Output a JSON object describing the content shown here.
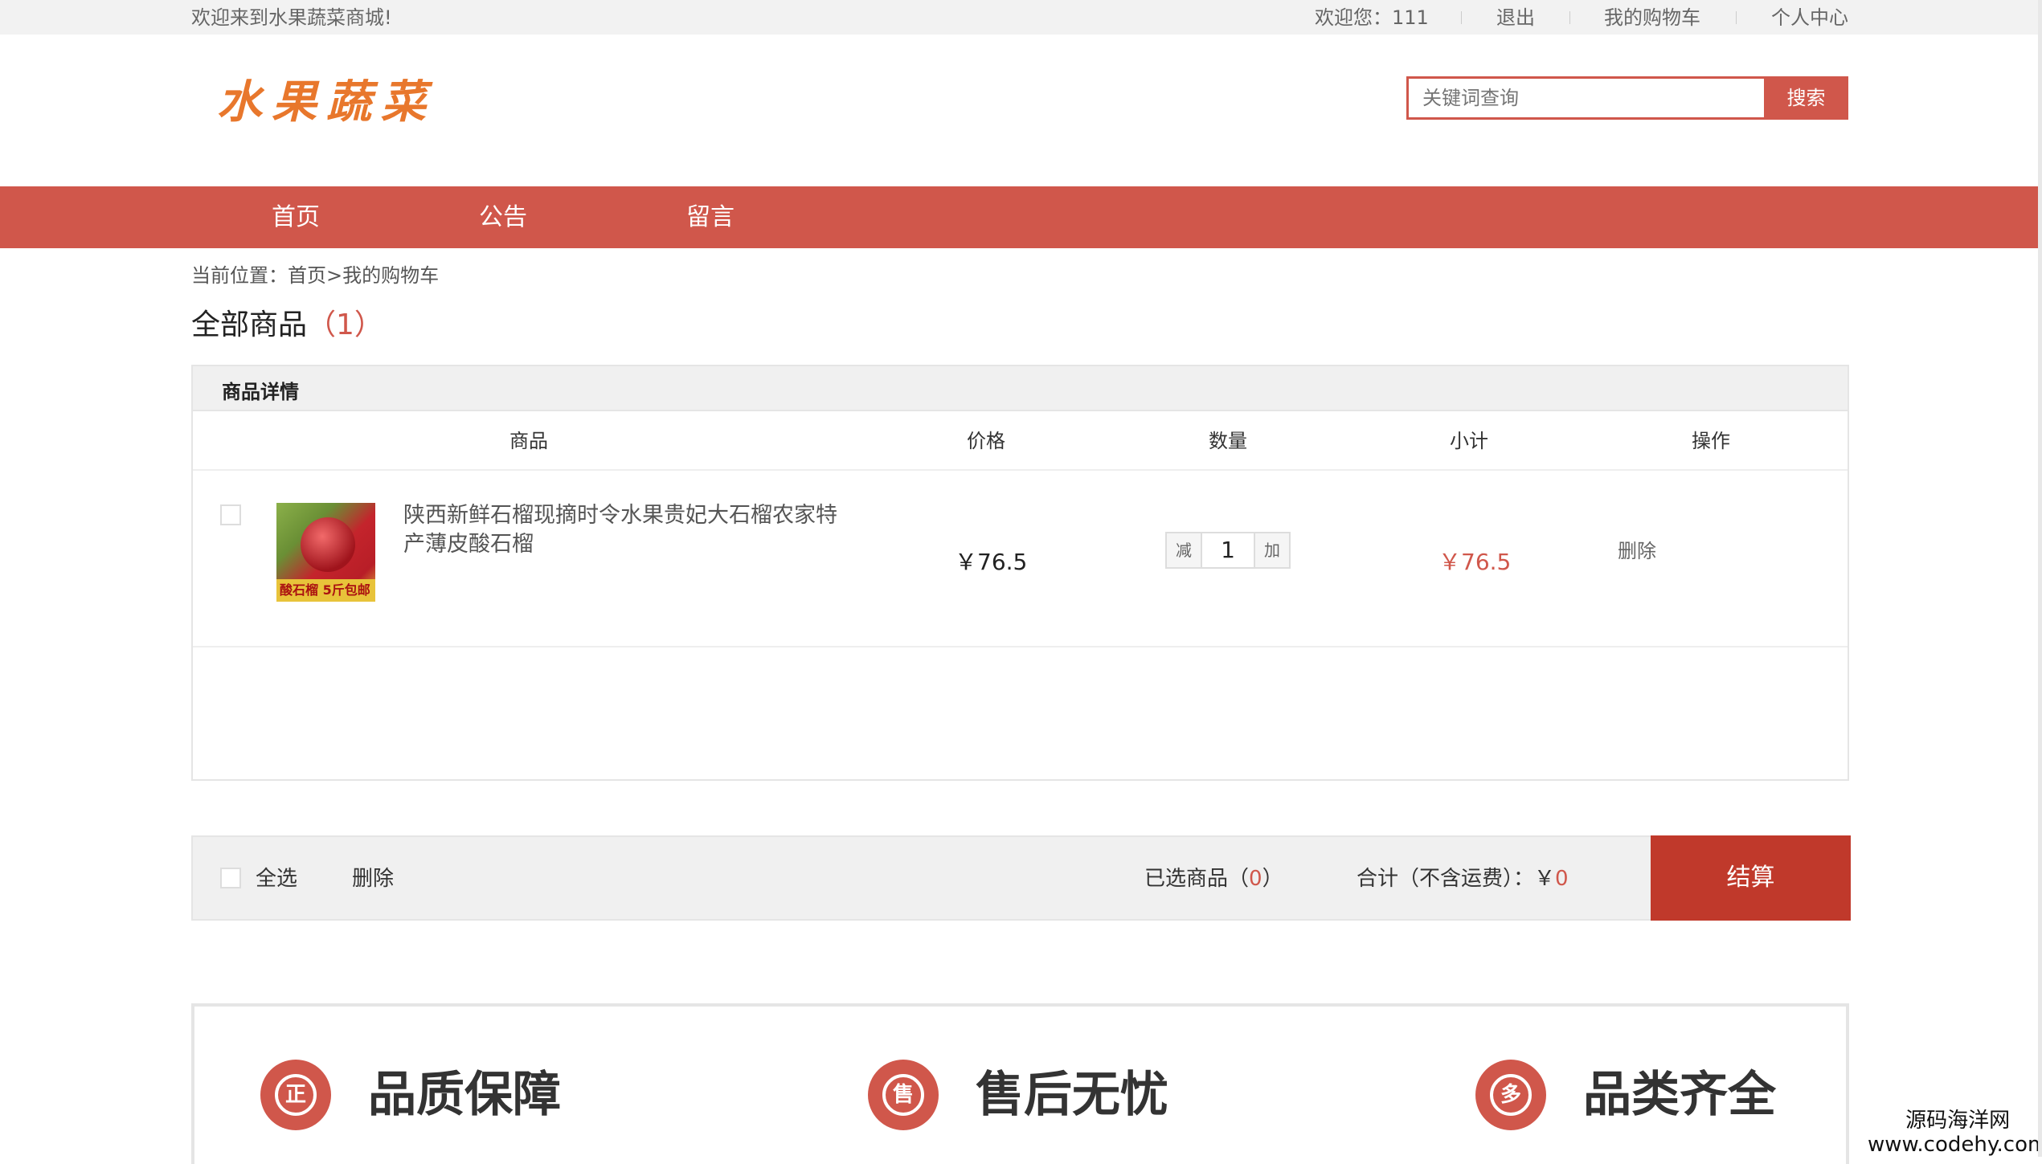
{
  "topbar": {
    "welcome": "欢迎来到水果蔬菜商城!",
    "user_greeting": "欢迎您：111",
    "logout": "退出",
    "my_cart": "我的购物车",
    "personal_center": "个人中心"
  },
  "header": {
    "logo_text": "水果蔬菜",
    "search_placeholder": "关键词查询",
    "search_button": "搜索"
  },
  "nav": {
    "items": [
      "首页",
      "公告",
      "留言"
    ]
  },
  "breadcrumb": {
    "prefix": "当前位置：",
    "home": "首页",
    "current": ">我的购物车"
  },
  "cart": {
    "title": "全部商品",
    "count": "（1）",
    "panel_title": "商品详情",
    "columns": [
      "商品",
      "价格",
      "数量",
      "小计",
      "操作"
    ],
    "items": [
      {
        "name": "陕西新鲜石榴现摘时令水果贵妃大石榴农家特产薄皮酸石榴",
        "image_label": "酸石榴 5斤包邮",
        "price": "￥76.5",
        "qty_minus": "减",
        "quantity": "1",
        "qty_plus": "加",
        "subtotal": "￥76.5",
        "action": "删除",
        "checked": false
      }
    ]
  },
  "footer_bar": {
    "select_all": "全选",
    "delete": "删除",
    "selected_label": "已选商品（",
    "selected_count": "0",
    "selected_suffix": "）",
    "total_label": "合计（不含运费）：￥",
    "total_value": "0",
    "checkout": "结算"
  },
  "guarantees": [
    {
      "icon": "正",
      "text": "品质保障"
    },
    {
      "icon": "售",
      "text": "售后无忧"
    },
    {
      "icon": "多",
      "text": "品类齐全"
    }
  ],
  "watermark": {
    "line1": "源码海洋网",
    "line2": "www.codehy.com"
  },
  "colors": {
    "accent": "#d0574b",
    "checkout": "#c0392b",
    "logo": "#e8772c"
  }
}
